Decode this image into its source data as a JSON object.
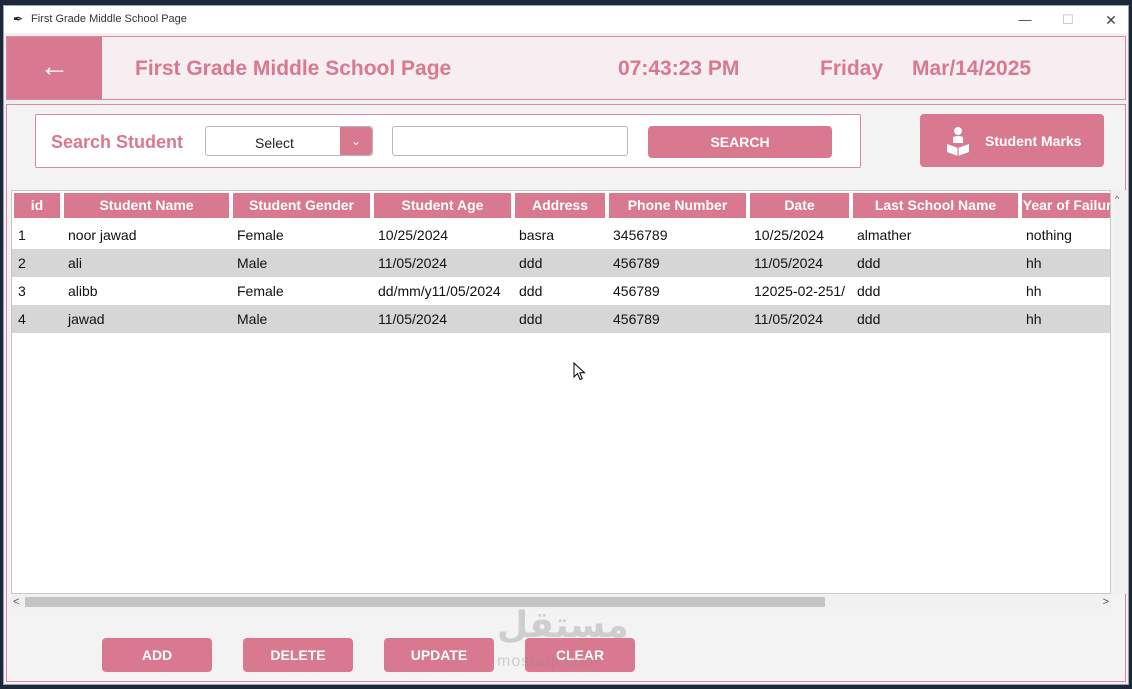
{
  "window": {
    "title": "First Grade Middle School Page",
    "minimize": "—",
    "maximize": "☐",
    "close": "✕"
  },
  "header": {
    "back": "←",
    "title": "First Grade Middle School Page",
    "time": "07:43:23 PM",
    "day": "Friday",
    "date": "Mar/14/2025"
  },
  "search": {
    "label": "Search Student",
    "select_value": "Select",
    "input_value": "",
    "button": "SEARCH"
  },
  "marks_button": "Student Marks",
  "table": {
    "columns": [
      "id",
      "Student Name",
      "Student Gender",
      "Student Age",
      "Address",
      "Phone Number",
      "Date",
      "Last School Name",
      "Year of Failure"
    ],
    "rows": [
      [
        "1",
        "noor jawad",
        "Female",
        "10/25/2024",
        "basra",
        "3456789",
        "10/25/2024",
        "almather",
        "nothing"
      ],
      [
        "2",
        "ali",
        "Male",
        "11/05/2024",
        "ddd",
        "456789",
        "11/05/2024",
        "ddd",
        "hh"
      ],
      [
        "3",
        "alibb",
        "Female",
        "dd/mm/y11/05/2024",
        "ddd",
        "456789",
        "12025-02-251/",
        "ddd",
        "hh"
      ],
      [
        "4",
        "jawad",
        "Male",
        "11/05/2024",
        "ddd",
        "456789",
        "11/05/2024",
        "ddd",
        "hh"
      ]
    ]
  },
  "scroll": {
    "up": "^",
    "left": "<",
    "right": ">"
  },
  "actions": {
    "add": "ADD",
    "delete": "DELETE",
    "update": "UPDATE",
    "clear": "CLEAR"
  },
  "watermark": {
    "arabic": "مستقل",
    "latin": "mostaql.com"
  },
  "colors": {
    "accent": "#d9798f",
    "header_bg": "#f6eef0",
    "row_alt": "#d6d6d6"
  },
  "icons": {
    "back": "arrow-left-icon",
    "marks": "student-reading-icon",
    "select": "chevron-down-icon"
  }
}
